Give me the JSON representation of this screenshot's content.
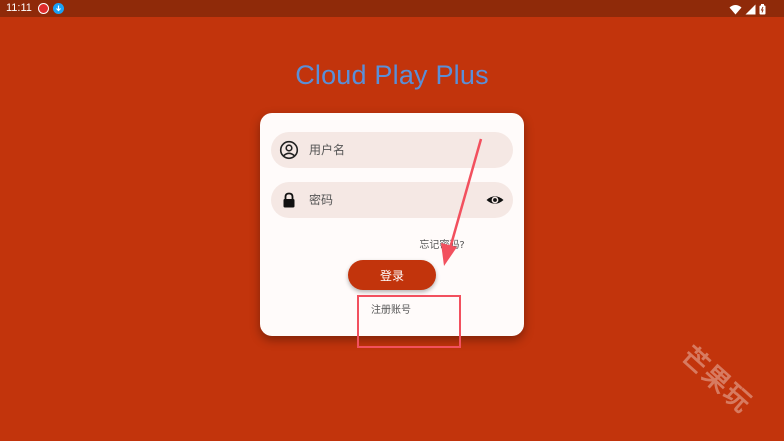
{
  "status_bar": {
    "time": "11:11",
    "icons": [
      "app-notification-icon",
      "download-notification-icon",
      "wifi-icon",
      "signal-icon",
      "battery-icon"
    ]
  },
  "app": {
    "title": "Cloud Play Plus"
  },
  "login_form": {
    "username_placeholder": "用户名",
    "password_placeholder": "密码",
    "forgot_password": "忘记密码?",
    "login_label": "登录",
    "register_label": "注册账号",
    "icons": {
      "username": "account-circle-icon",
      "password": "lock-icon",
      "toggle": "eye-icon"
    }
  },
  "annotation": {
    "color": "#F2505E"
  },
  "watermark": {
    "text": "芒果玩"
  },
  "colors": {
    "background": "#C2340C",
    "status_bar": "#8F2A09",
    "title": "#5A8FD8",
    "card": "#FFFBFA",
    "field": "#F5E8E4",
    "button": "#C2340C"
  }
}
